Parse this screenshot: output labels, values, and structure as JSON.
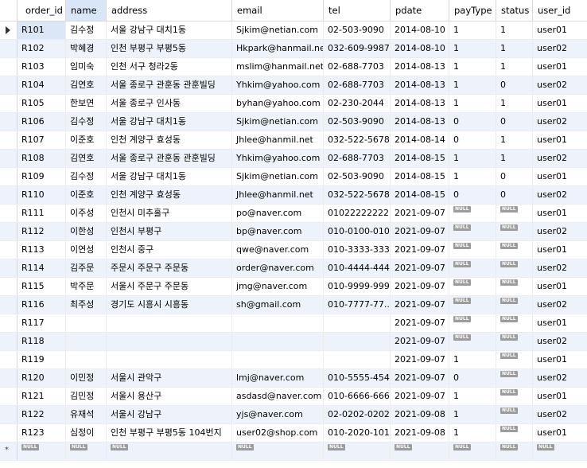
{
  "columns": [
    {
      "key": "order_id",
      "label": "order_id"
    },
    {
      "key": "name",
      "label": "name"
    },
    {
      "key": "address",
      "label": "address"
    },
    {
      "key": "email",
      "label": "email"
    },
    {
      "key": "tel",
      "label": "tel"
    },
    {
      "key": "pdate",
      "label": "pdate"
    },
    {
      "key": "payType",
      "label": "payType"
    },
    {
      "key": "status",
      "label": "status"
    },
    {
      "key": "user_id",
      "label": "user_id"
    }
  ],
  "selected_column": "name",
  "null_label": "NULL",
  "new_row_marker": "*",
  "rows": [
    [
      "R101",
      "김수정",
      "서울 강남구 대치1동",
      "Sjkim@netian.com",
      "02-503-9090",
      "2014-08-10",
      "1",
      "1",
      "user01"
    ],
    [
      "R102",
      "박혜경",
      "인천 부평구 부평5동",
      "Hkpark@hanmail.net",
      "032-609-9987",
      "2014-08-10",
      "1",
      "1",
      "user02"
    ],
    [
      "R103",
      "임미숙",
      "인천 서구 청라2동",
      "mslim@hanmail.net",
      "02-688-7703",
      "2014-08-13",
      "1",
      "1",
      "user01"
    ],
    [
      "R104",
      "김연호",
      "서울 종로구 관훈동 관훈빌딩",
      "Yhkim@yahoo.com",
      "02-688-7703",
      "2014-08-13",
      "1",
      "0",
      "user02"
    ],
    [
      "R105",
      "한보연",
      "서울 종로구 인사동",
      "byhan@yahoo.com",
      "02-230-2044",
      "2014-08-13",
      "1",
      "1",
      "user01"
    ],
    [
      "R106",
      "김수정",
      "서울 강남구 대치1동",
      "Sjkim@netian.com",
      "02-503-9090",
      "2014-08-13",
      "0",
      "0",
      "user02"
    ],
    [
      "R107",
      "이준호",
      "인천 계양구 효성동",
      "Jhlee@hanmil.net",
      "032-522-5678",
      "2014-08-14",
      "0",
      "1",
      "user01"
    ],
    [
      "R108",
      "김연호",
      "서울 종로구 관훈동 관훈빌딩",
      "Yhkim@yahoo.com",
      "02-688-7703",
      "2014-08-15",
      "1",
      "1",
      "user02"
    ],
    [
      "R109",
      "김수정",
      "서울 강남구 대치1동",
      "Sjkim@netian.com",
      "02-503-9090",
      "2014-08-15",
      "1",
      "0",
      "user01"
    ],
    [
      "R110",
      "이준호",
      "인천 계양구 효성동",
      "Jhlee@hanmil.net",
      "032-522-5678",
      "2014-08-15",
      "0",
      "0",
      "user02"
    ],
    [
      "R111",
      "이주성",
      "인천시 미추홀구",
      "po@naver.com",
      "01022222222",
      "2021-09-07",
      null,
      null,
      "user01"
    ],
    [
      "R112",
      "이한성",
      "인천시 부평구",
      "bp@naver.com",
      "010-0100-0100",
      "2021-09-07",
      null,
      null,
      "user02"
    ],
    [
      "R113",
      "이연성",
      "인천시 중구",
      "qwe@naver.com",
      "010-3333-3333",
      "2021-09-07",
      null,
      null,
      "user01"
    ],
    [
      "R114",
      "김주문",
      "주문시 주문구 주문동",
      "order@naver.com",
      "010-4444-4444",
      "2021-09-07",
      null,
      null,
      "user02"
    ],
    [
      "R115",
      "박주문",
      "서울시 주문구 주문동",
      "jmg@naver.com",
      "010-9999-9999",
      "2021-09-07",
      null,
      null,
      "user01"
    ],
    [
      "R116",
      "최주성",
      "경기도 시흥시 시흥동",
      "sh@gmail.com",
      "010-7777-77...",
      "2021-09-07",
      null,
      null,
      "user02"
    ],
    [
      "R117",
      "",
      "",
      "",
      "",
      "2021-09-07",
      null,
      null,
      "user01"
    ],
    [
      "R118",
      "",
      "",
      "",
      "",
      "2021-09-07",
      null,
      null,
      "user02"
    ],
    [
      "R119",
      "",
      "",
      "",
      "",
      "2021-09-07",
      "1",
      null,
      "user01"
    ],
    [
      "R120",
      "이민정",
      "서울시 관악구",
      "lmj@naver.com",
      "010-5555-4545",
      "2021-09-07",
      "0",
      null,
      "user02"
    ],
    [
      "R121",
      "김민정",
      "서울시 용산구",
      "asdasd@naver.com",
      "010-6666-6666",
      "2021-09-07",
      "1",
      null,
      "user01"
    ],
    [
      "R122",
      "유재석",
      "서울시 강남구",
      "yjs@naver.com",
      "02-0202-0202",
      "2021-09-08",
      "1",
      null,
      "user02"
    ],
    [
      "R123",
      "심정이",
      "인천 부평구 부평5동 104번지",
      "user02@shop.com",
      "010-2020-1010",
      "2021-09-08",
      "1",
      null,
      "user01"
    ],
    [
      null,
      null,
      null,
      null,
      null,
      null,
      null,
      null,
      null
    ]
  ]
}
